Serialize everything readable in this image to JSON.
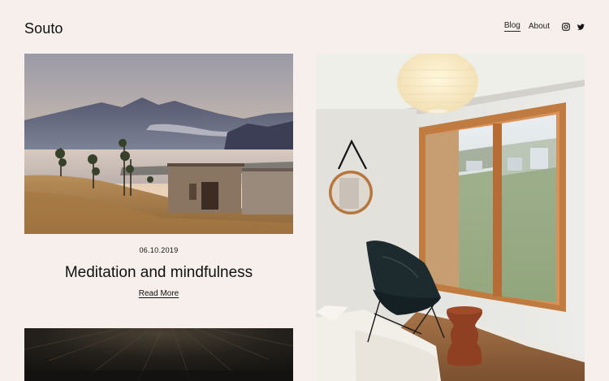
{
  "site": {
    "logo": "Souto"
  },
  "nav": {
    "items": [
      {
        "label": "Blog",
        "active": true
      },
      {
        "label": "About",
        "active": false
      }
    ]
  },
  "social": {
    "icons": [
      "instagram-icon",
      "twitter-icon"
    ]
  },
  "featured_post": {
    "date": "06.10.2019",
    "title": "Meditation and mindfulness",
    "cta": "Read More"
  }
}
